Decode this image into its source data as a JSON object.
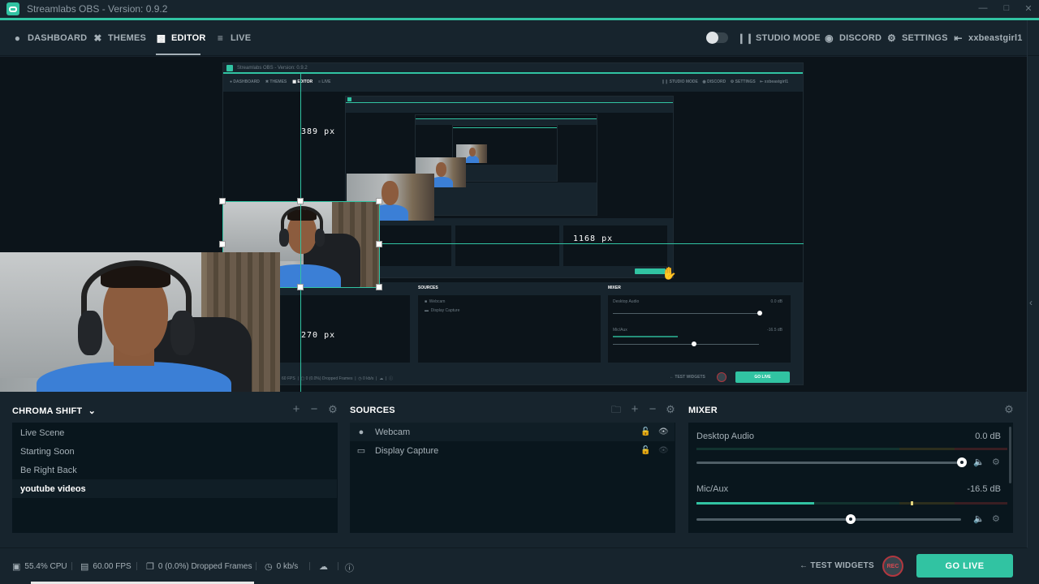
{
  "window": {
    "title": "Streamlabs OBS - Version: 0.9.2",
    "controls": [
      "minimize",
      "maximize",
      "close"
    ]
  },
  "nav": {
    "left": [
      {
        "label": "DASHBOARD",
        "icon": "dashboard-icon",
        "active": false
      },
      {
        "label": "THEMES",
        "icon": "themes-icon",
        "active": false
      },
      {
        "label": "EDITOR",
        "icon": "editor-icon",
        "active": true
      },
      {
        "label": "LIVE",
        "icon": "live-icon",
        "active": false
      }
    ],
    "right": [
      {
        "label": "STUDIO MODE",
        "icon": "studio-mode-icon"
      },
      {
        "label": "DISCORD",
        "icon": "discord-icon"
      },
      {
        "label": "SETTINGS",
        "icon": "settings-icon"
      },
      {
        "label": "xxbeastgirl1",
        "icon": "logout-icon"
      }
    ],
    "night_mode_toggle": "on"
  },
  "editor": {
    "guides": {
      "top": "389 px",
      "right": "1168 px",
      "bottom": "270 px"
    },
    "nested_preview_title": "Streamlabs OBS - Version: 0.9.2"
  },
  "scenes": {
    "title": "CHROMA SHIFT",
    "items": [
      {
        "label": "Live Scene",
        "active": false
      },
      {
        "label": "Starting Soon",
        "active": false
      },
      {
        "label": "Be Right Back",
        "active": false
      },
      {
        "label": "youtube videos",
        "active": true
      }
    ]
  },
  "sources": {
    "title": "SOURCES",
    "items": [
      {
        "label": "Webcam",
        "icon": "webcam-icon",
        "visible": true,
        "locked": false
      },
      {
        "label": "Display Capture",
        "icon": "monitor-icon",
        "visible": false,
        "locked": false
      }
    ]
  },
  "mixer": {
    "title": "MIXER",
    "channels": [
      {
        "name": "Desktop Audio",
        "db": "0.0 dB",
        "volume": 1.0,
        "level": 0.0
      },
      {
        "name": "Mic/Aux",
        "db": "-16.5 dB",
        "volume": 0.58,
        "level": 0.39
      }
    ]
  },
  "footer": {
    "cpu": "55.4% CPU",
    "fps": "60.00 FPS",
    "dropped": "0 (0.0%) Dropped Frames",
    "bitrate": "0 kb/s",
    "test_widgets": "TEST WIDGETS",
    "rec": "REC",
    "go_live": "GO LIVE"
  },
  "colors": {
    "accent": "#31c3a2",
    "background": "#17242d",
    "panel": "#09161d",
    "rec": "#b2373f"
  }
}
